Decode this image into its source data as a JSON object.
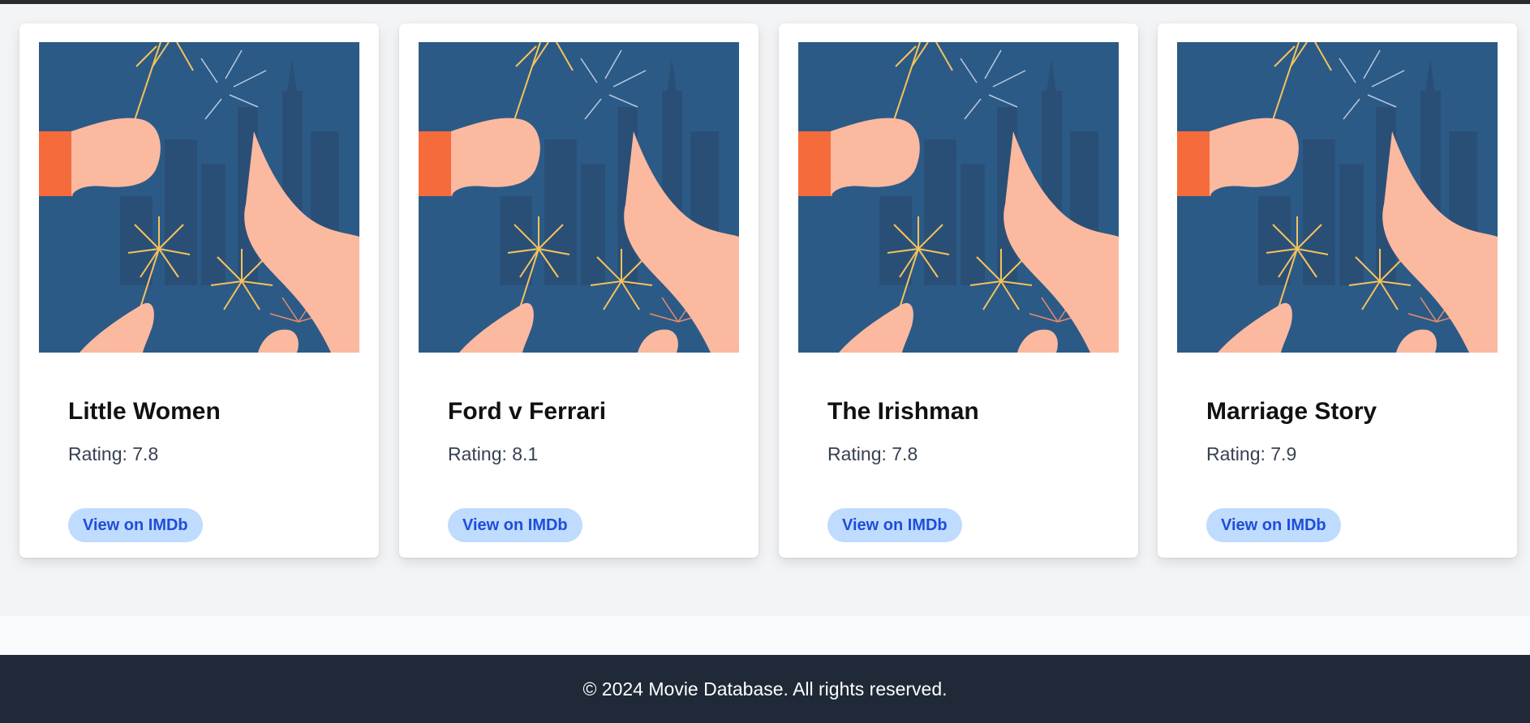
{
  "movies": [
    {
      "title": "Little Women",
      "rating": "Rating: 7.8",
      "button_label": "View on IMDb"
    },
    {
      "title": "Ford v Ferrari",
      "rating": "Rating: 8.1",
      "button_label": "View on IMDb"
    },
    {
      "title": "The Irishman",
      "rating": "Rating: 7.8",
      "button_label": "View on IMDb"
    },
    {
      "title": "Marriage Story",
      "rating": "Rating: 7.9",
      "button_label": "View on IMDb"
    }
  ],
  "footer": {
    "text": "© 2024 Movie Database. All rights reserved."
  },
  "colors": {
    "page_background": "#f3f4f6",
    "card_background": "#ffffff",
    "button_background": "#bfdbfe",
    "button_text": "#1d4ed8",
    "footer_background": "#1f2937",
    "poster_background": "#2c5a86"
  },
  "icons": {
    "poster": "fireworks-illustration"
  }
}
